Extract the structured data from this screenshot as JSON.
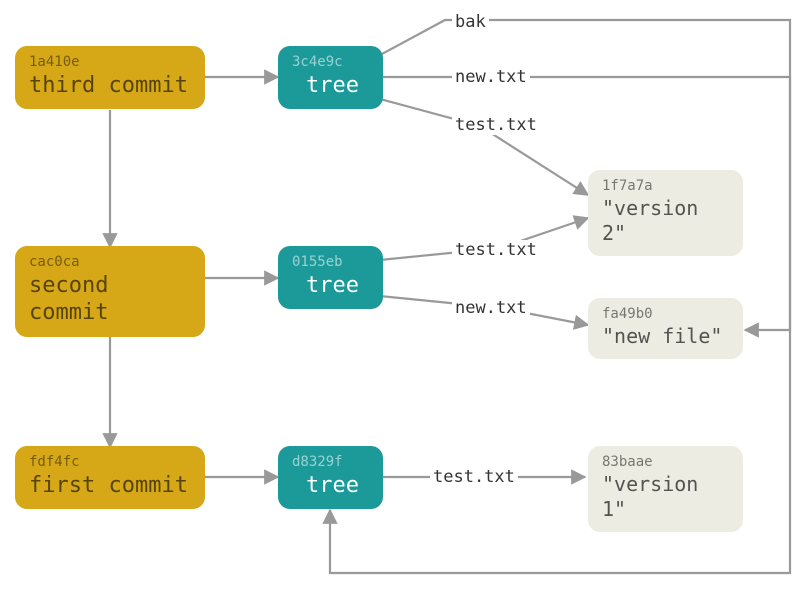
{
  "commits": [
    {
      "hash": "1a410e",
      "msg": "third commit"
    },
    {
      "hash": "cac0ca",
      "msg": "second commit"
    },
    {
      "hash": "fdf4fc",
      "msg": "first commit"
    }
  ],
  "trees": [
    {
      "hash": "3c4e9c",
      "msg": "tree"
    },
    {
      "hash": "0155eb",
      "msg": "tree"
    },
    {
      "hash": "d8329f",
      "msg": "tree"
    }
  ],
  "blobs": [
    {
      "hash": "1f7a7a",
      "msg": "\"version 2\""
    },
    {
      "hash": "fa49b0",
      "msg": "\"new file\""
    },
    {
      "hash": "83baae",
      "msg": "\"version 1\""
    }
  ],
  "labels": {
    "bak": "bak",
    "newtxt1": "new.txt",
    "testtxt1": "test.txt",
    "testtxt2": "test.txt",
    "newtxt2": "new.txt",
    "testtxt3": "test.txt"
  }
}
